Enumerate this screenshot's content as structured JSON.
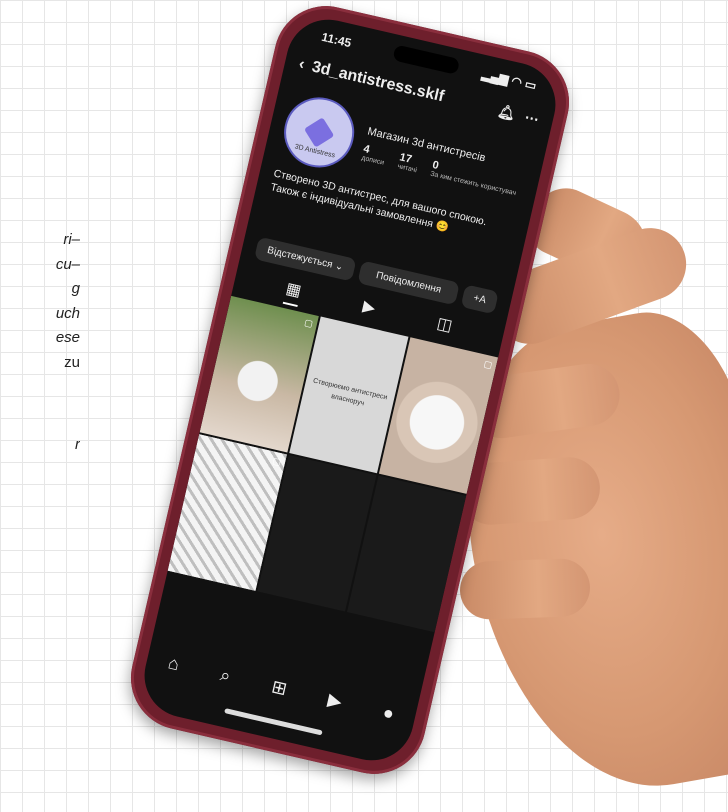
{
  "background_text": {
    "lines": [
      "ri–",
      "cu–",
      "g",
      "uch",
      "ese",
      "zu",
      "r"
    ]
  },
  "phone": {
    "status_time": "11:45",
    "status_icons": "signal-wifi-battery-icons",
    "username": "3d_antistress.sklf",
    "profile": {
      "avatar_label": "3D Antistress",
      "name": "Магазин 3d антистресів",
      "stats": [
        {
          "value": "4",
          "label": "дописи"
        },
        {
          "value": "17",
          "label": "читачі"
        },
        {
          "value": "0",
          "label": "За ким стежить користувач"
        }
      ],
      "bio_line1": "Створено 3D антистрес, для вашого спокою.",
      "bio_line2": "Також є індивідуальні замовлення 😊"
    },
    "buttons": {
      "follow": "Відстежується ⌄",
      "message": "Повідомлення",
      "add": "+A"
    },
    "grid_text_post": "Створюємо антистреси власноруч"
  }
}
